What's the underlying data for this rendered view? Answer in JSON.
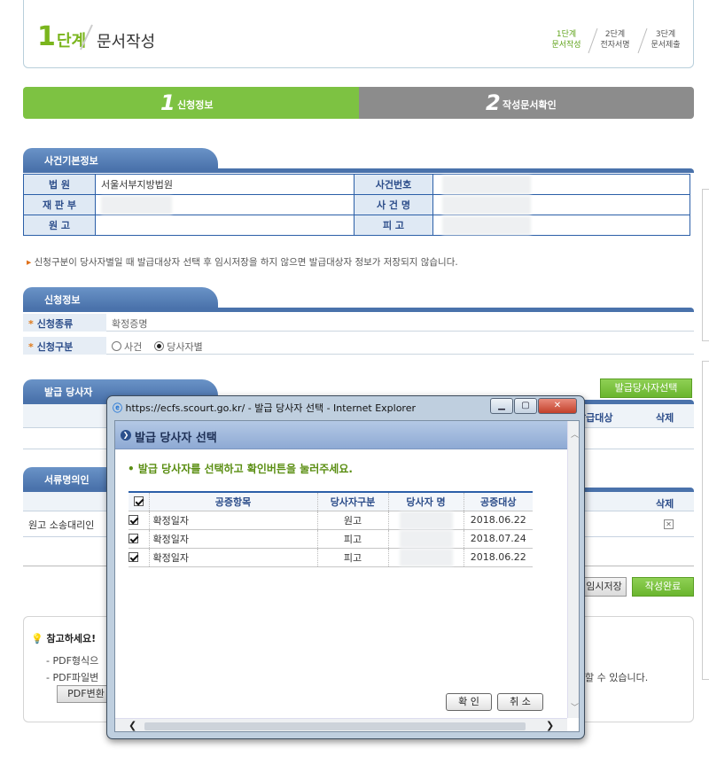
{
  "header": {
    "step_num": "1",
    "step_word": "단계",
    "title": "문서작성",
    "steps": [
      {
        "num": "1단계",
        "name": "문서작성"
      },
      {
        "num": "2단계",
        "name": "전자서명"
      },
      {
        "num": "3단계",
        "name": "문서제출"
      }
    ]
  },
  "tabs": [
    {
      "num": "1",
      "label": "신청정보"
    },
    {
      "num": "2",
      "label": "작성문서확인"
    }
  ],
  "case_info": {
    "section_title": "사건기본정보",
    "court_label": "법 원",
    "court_value": "서울서부지방법원",
    "case_no_label": "사건번호",
    "division_label": "재 판 부",
    "case_name_label": "사 건 명",
    "plaintiff_label": "원 고",
    "defendant_label": "피 고"
  },
  "notice": "신청구분이 당사자별일 때 발급대상자 선택 후 임시저장을 하지 않으면 발급대상자 정보가 저장되지 않습니다.",
  "application": {
    "section_title": "신청정보",
    "type_label": "신청종류",
    "type_value": "확정증명",
    "category_label": "신청구분",
    "option_case": "사건",
    "option_party": "당사자별"
  },
  "issue": {
    "section_title": "발급 당사자",
    "select_button": "발급당사자선택",
    "col_target": "발급대상",
    "col_delete": "삭제"
  },
  "docs": {
    "section_title": "서류명의인",
    "col_delete": "삭제",
    "row1_text": "원고 소송대리인",
    "temp_save": "임시저장",
    "complete": "작성완료"
  },
  "reference": {
    "title": "참고하세요!",
    "line1": "- PDF형식으",
    "line2": "- PDF파일변",
    "tail": "할 수 있습니다.",
    "pdf_button": "PDF변환"
  },
  "popup": {
    "window_title": "https://ecfs.scourt.go.kr/ - 발급 당사자 선택 - Internet Explorer",
    "title": "발급 당사자 선택",
    "instruction": "발급 당사자를 선택하고 확인버튼을 눌러주세요.",
    "columns": [
      "공증항목",
      "당사자구분",
      "당사자 명",
      "공증대상"
    ],
    "rows": [
      {
        "item": "확정일자",
        "party_type": "원고",
        "target": "2018.06.22"
      },
      {
        "item": "확정일자",
        "party_type": "피고",
        "target": "2018.07.24"
      },
      {
        "item": "확정일자",
        "party_type": "피고",
        "target": "2018.06.22"
      }
    ],
    "ok": "확 인",
    "cancel": "취 소"
  }
}
